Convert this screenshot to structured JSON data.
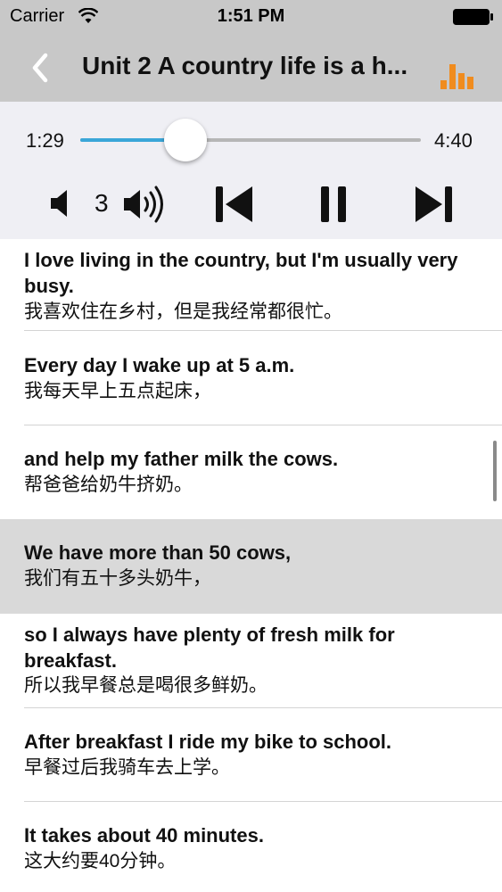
{
  "status_bar": {
    "carrier": "Carrier",
    "time": "1:51 PM",
    "icons": [
      "wifi-icon",
      "battery-icon"
    ]
  },
  "nav": {
    "back_icon": "chevron-left-icon",
    "title": "Unit 2 A country life is a h...",
    "menu_icon": "bar-chart-icon",
    "accent_color": "#f08c1e"
  },
  "player": {
    "elapsed": "1:29",
    "total": "4:40",
    "progress": 0.31,
    "progress_color": "#3aa6d8",
    "volume_level": "3",
    "controls": [
      "volume-down-icon",
      "volume-up-icon",
      "skip-previous-icon",
      "pause-icon",
      "skip-next-icon"
    ]
  },
  "sentences": [
    {
      "en": "I love living in the country, but I'm usually very busy.",
      "zh": "我喜欢住在乡村，但是我经常都很忙。",
      "selected": false
    },
    {
      "en": "Every day I wake up at 5 a.m.",
      "zh": "我每天早上五点起床，",
      "selected": false
    },
    {
      "en": "and help my father milk the cows.",
      "zh": "帮爸爸给奶牛挤奶。",
      "selected": false
    },
    {
      "en": "We have more than 50 cows,",
      "zh": "我们有五十多头奶牛，",
      "selected": true
    },
    {
      "en": "so I always have plenty of fresh milk for breakfast.",
      "zh": "所以我早餐总是喝很多鲜奶。",
      "selected": false
    },
    {
      "en": "After breakfast I ride my bike to school.",
      "zh": "早餐过后我骑车去上学。",
      "selected": false
    },
    {
      "en": "It takes about 40 minutes.",
      "zh": "这大约要40分钟。",
      "selected": false
    }
  ]
}
